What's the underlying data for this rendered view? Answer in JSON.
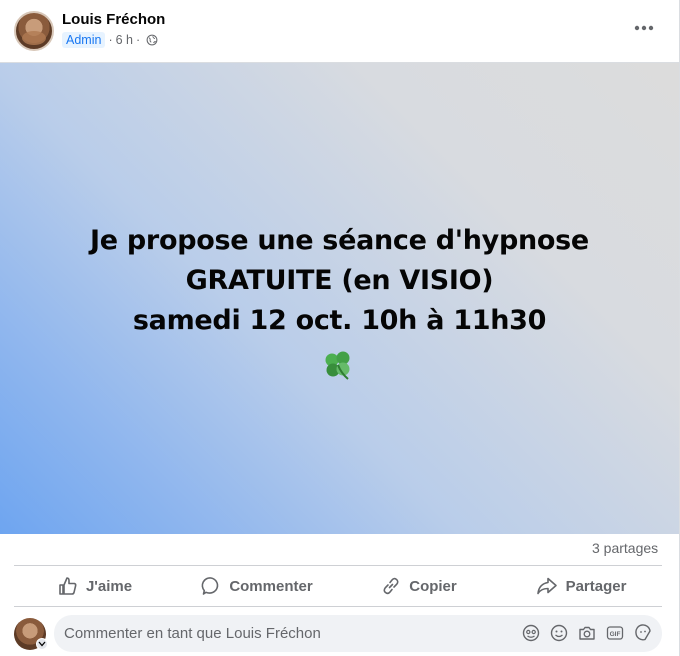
{
  "post": {
    "author": "Louis Fréchon",
    "badge": "Admin",
    "separator1": "·",
    "time": "6 h",
    "separator2": "·",
    "visibility_icon": "globe-icon",
    "more_icon": "more-horizontal-icon",
    "image": {
      "lines": [
        "Je propose une séance d'hypnose",
        "GRATUITE (en VISIO)",
        "samedi 12 oct. 10h à 11h30"
      ],
      "emoji": "clover-icon",
      "gradient_colors": [
        "#dcdcdc",
        "#6ea5f0"
      ]
    },
    "shares": "3 partages",
    "actions": [
      {
        "label": "J'aime",
        "icon": "thumbs-up-icon"
      },
      {
        "label": "Commenter",
        "icon": "comment-bubble-icon"
      },
      {
        "label": "Copier",
        "icon": "link-icon"
      },
      {
        "label": "Partager",
        "icon": "share-arrow-icon"
      }
    ],
    "composer": {
      "placeholder": "Commenter en tant que Louis Fréchon",
      "icons": [
        "avatar-sticker-icon",
        "emoji-icon",
        "camera-icon",
        "gif-icon",
        "sticker-icon"
      ]
    }
  },
  "colors": {
    "accent": "#1877f2",
    "secondary_text": "#65676b",
    "divider": "#ced0d4"
  }
}
